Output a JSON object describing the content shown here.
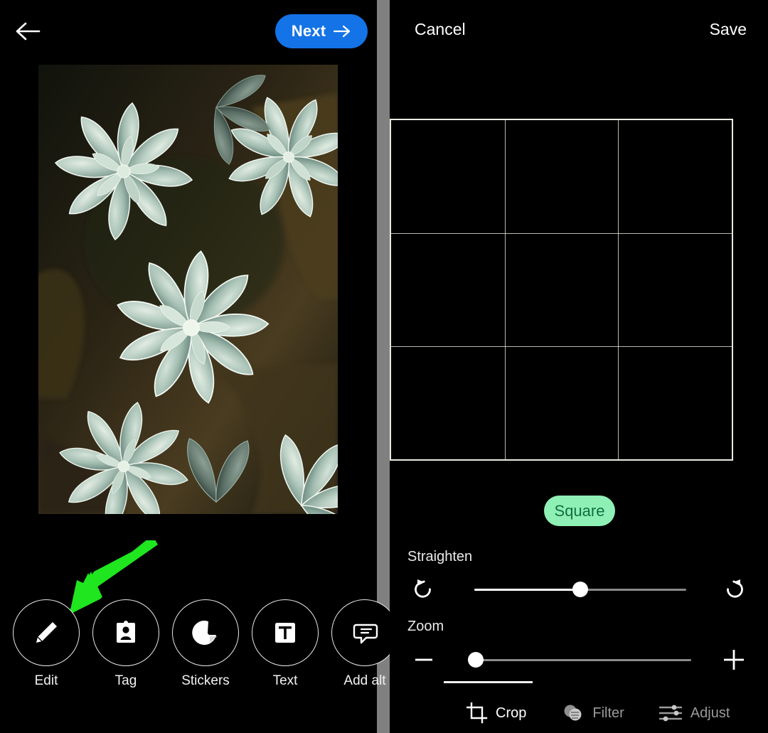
{
  "left_panel": {
    "topbar": {
      "back_icon": "arrow-left-icon",
      "next_label": "Next",
      "next_icon": "arrow-right-icon",
      "next_bg": "#1473e6"
    },
    "photo": {
      "alt": "close-up of pale green echeveria succulent rosettes"
    },
    "annotation": {
      "arrow_color": "#1fe61f",
      "points_to": "Edit"
    },
    "tools": [
      {
        "label": "Edit",
        "icon": "pencil-icon"
      },
      {
        "label": "Tag",
        "icon": "tag-person-icon"
      },
      {
        "label": "Stickers",
        "icon": "sticker-icon"
      },
      {
        "label": "Text",
        "icon": "text-box-icon"
      },
      {
        "label": "Add alt",
        "icon": "alt-text-icon"
      }
    ]
  },
  "right_panel": {
    "topbar": {
      "cancel_label": "Cancel",
      "save_label": "Save"
    },
    "crop": {
      "grid_lines": 3,
      "aspect_label": "Square",
      "aspect_pill_bg": "#8ff0b6",
      "aspect_pill_fg": "#11703f"
    },
    "straighten": {
      "label": "Straighten",
      "rotate_left_icon": "rotate-left-icon",
      "rotate_right_icon": "rotate-right-icon",
      "value_percent": 50
    },
    "zoom": {
      "label": "Zoom",
      "minus_icon": "minus-icon",
      "plus_icon": "plus-icon",
      "value_percent": 3
    },
    "tabs": [
      {
        "label": "Crop",
        "icon": "crop-icon",
        "active": true
      },
      {
        "label": "Filter",
        "icon": "filter-icon",
        "active": false
      },
      {
        "label": "Adjust",
        "icon": "adjust-sliders-icon",
        "active": false
      }
    ]
  }
}
